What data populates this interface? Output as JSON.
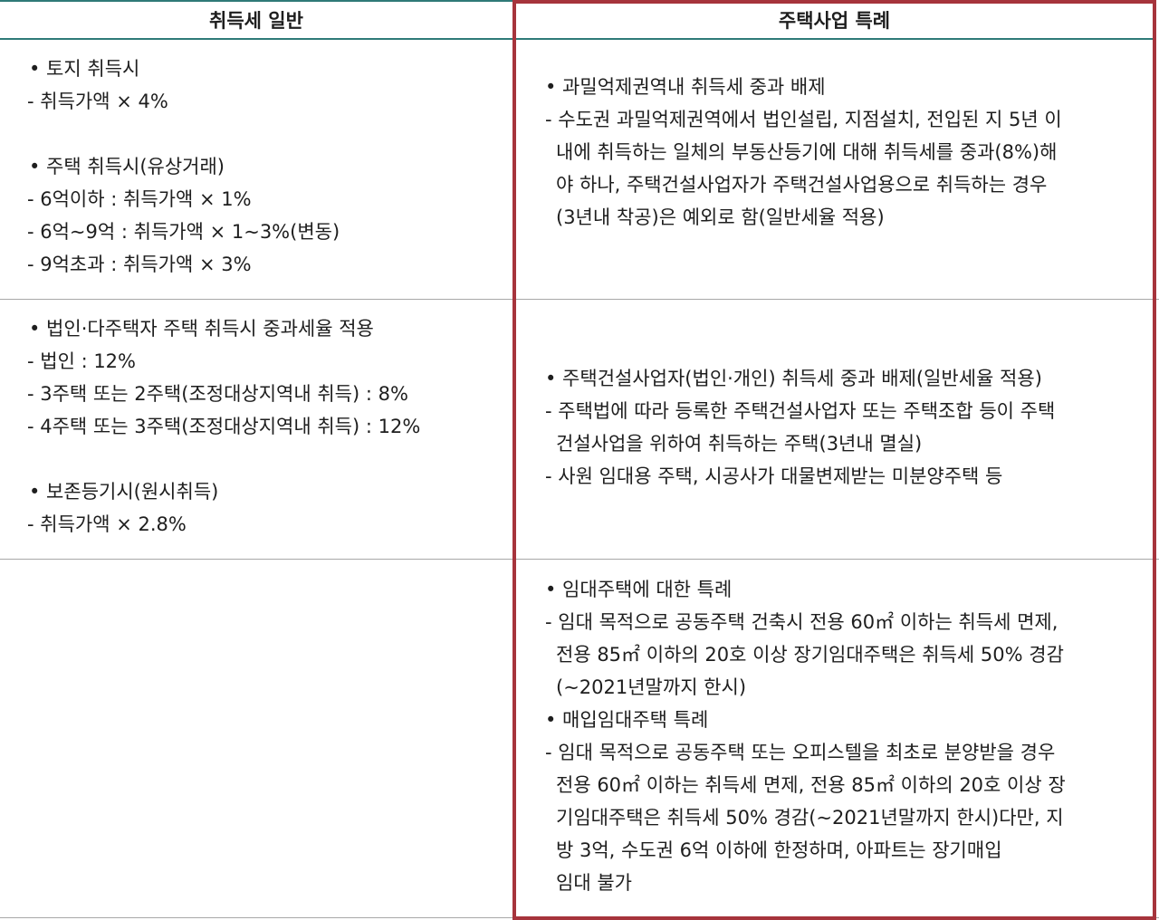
{
  "headers": {
    "left": "취득세 일반",
    "right": "주택사업 특례"
  },
  "rows": [
    {
      "left": [
        "•  토지 취득시",
        "- 취득가액 × 4%",
        "",
        "•  주택 취득시(유상거래)",
        "- 6억이하 : 취득가액 × 1%",
        "- 6억∼9억 : 취득가액 × 1∼3%(변동)",
        "- 9억초과 : 취득가액 × 3%"
      ],
      "right": [
        "•  과밀억제권역내 취득세 중과 배제",
        "-  수도권 과밀억제권역에서 법인설립, 지점설치, 전입된 지 5년 이",
        "내에 취득하는 일체의 부동산등기에 대해 취득세를 중과(8%)해",
        "야 하나, 주택건설사업자가 주택건설사업용으로 취득하는 경우",
        "(3년내 착공)은 예외로 함(일반세율 적용)"
      ]
    },
    {
      "left": [
        "•  법인·다주택자 주택 취득시 중과세율 적용",
        "- 법인 : 12%",
        "- 3주택 또는 2주택(조정대상지역내 취득) : 8%",
        "- 4주택 또는 3주택(조정대상지역내 취득) : 12%",
        "",
        "•  보존등기시(원시취득)",
        "- 취득가액 × 2.8%"
      ],
      "right": [
        "•  주택건설사업자(법인·개인) 취득세 중과 배제(일반세율 적용)",
        "-  주택법에 따라 등록한 주택건설사업자 또는 주택조합 등이 주택",
        "건설사업을 위하여 취득하는 주택(3년내 멸실)",
        "- 사원 임대용 주택, 시공사가 대물변제받는 미분양주택 등"
      ]
    },
    {
      "left": [],
      "right": [
        "•  임대주택에 대한 특례",
        "-  임대 목적으로 공동주택 건축시 전용 60㎡ 이하는 취득세 면제,",
        "전용 85㎡ 이하의 20호 이상 장기임대주택은 취득세 50% 경감",
        "(∼2021년말까지 한시)",
        "•  매입임대주택 특례",
        "-  임대 목적으로 공동주택 또는 오피스텔을 최초로 분양받을 경우",
        "전용 60㎡ 이하는 취득세 면제, 전용 85㎡ 이하의 20호 이상 장",
        "기임대주택은 취득세 50% 경감(∼2021년말까지 한시)다만, 지",
        "방 3억, 수도권 6억 이하에 한정하며, 아파트는 장기매입",
        "임대 불가"
      ]
    }
  ],
  "colors": {
    "header_rule": "#2f7a78",
    "highlight_border": "#a6343c",
    "text": "#1e1e1e"
  }
}
